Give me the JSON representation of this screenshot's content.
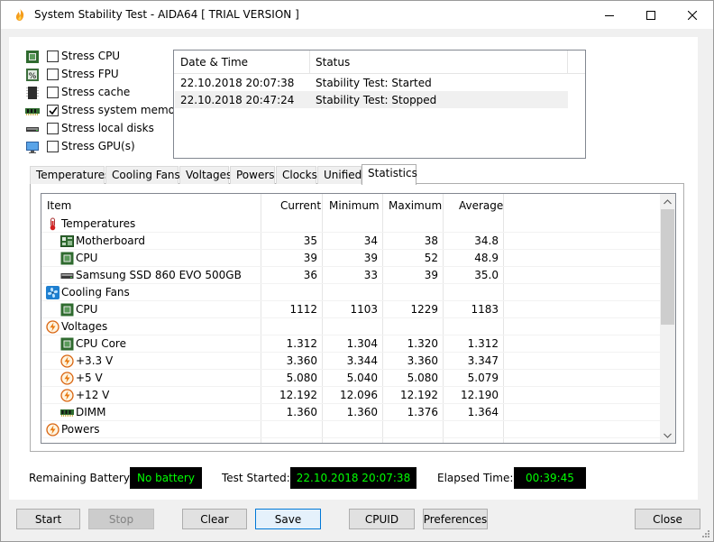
{
  "window": {
    "title": "System Stability Test - AIDA64  [ TRIAL VERSION ]",
    "colors": {
      "accent": "#0078d7",
      "panel_bg": "#000000",
      "panel_text": "#00ff00"
    }
  },
  "stress_options": [
    {
      "label": "Stress CPU",
      "checked": false,
      "icon": "cpu-icon"
    },
    {
      "label": "Stress FPU",
      "checked": false,
      "icon": "fpu-icon"
    },
    {
      "label": "Stress cache",
      "checked": false,
      "icon": "cache-icon"
    },
    {
      "label": "Stress system memory",
      "checked": true,
      "icon": "memory-icon"
    },
    {
      "label": "Stress local disks",
      "checked": false,
      "icon": "disk-icon"
    },
    {
      "label": "Stress GPU(s)",
      "checked": false,
      "icon": "monitor-icon"
    }
  ],
  "log": {
    "headers": {
      "datetime": "Date & Time",
      "status": "Status"
    },
    "rows": [
      {
        "datetime": "22.10.2018 20:07:38",
        "status": "Stability Test: Started"
      },
      {
        "datetime": "22.10.2018 20:47:24",
        "status": "Stability Test: Stopped"
      }
    ]
  },
  "tabs": [
    "Temperatures",
    "Cooling Fans",
    "Voltages",
    "Powers",
    "Clocks",
    "Unified",
    "Statistics"
  ],
  "active_tab": "Statistics",
  "stats": {
    "headers": {
      "item": "Item",
      "current": "Current",
      "minimum": "Minimum",
      "maximum": "Maximum",
      "average": "Average"
    },
    "rows": [
      {
        "type": "group",
        "name": "Temperatures",
        "icon": "thermometer-icon"
      },
      {
        "type": "item",
        "name": "Motherboard",
        "icon": "motherboard-icon",
        "current": "35",
        "minimum": "34",
        "maximum": "38",
        "average": "34.8"
      },
      {
        "type": "item",
        "name": "CPU",
        "icon": "cpu-icon",
        "current": "39",
        "minimum": "39",
        "maximum": "52",
        "average": "48.9"
      },
      {
        "type": "item",
        "name": "Samsung SSD 860 EVO 500GB",
        "icon": "disk-icon",
        "current": "36",
        "minimum": "33",
        "maximum": "39",
        "average": "35.0"
      },
      {
        "type": "group",
        "name": "Cooling Fans",
        "icon": "fan-icon"
      },
      {
        "type": "item",
        "name": "CPU",
        "icon": "cpu-icon",
        "current": "1112",
        "minimum": "1103",
        "maximum": "1229",
        "average": "1183"
      },
      {
        "type": "group",
        "name": "Voltages",
        "icon": "voltage-icon"
      },
      {
        "type": "item",
        "name": "CPU Core",
        "icon": "cpu-icon",
        "current": "1.312",
        "minimum": "1.304",
        "maximum": "1.320",
        "average": "1.312"
      },
      {
        "type": "item",
        "name": "+3.3 V",
        "icon": "voltage-icon",
        "current": "3.360",
        "minimum": "3.344",
        "maximum": "3.360",
        "average": "3.347"
      },
      {
        "type": "item",
        "name": "+5 V",
        "icon": "voltage-icon",
        "current": "5.080",
        "minimum": "5.040",
        "maximum": "5.080",
        "average": "5.079"
      },
      {
        "type": "item",
        "name": "+12 V",
        "icon": "voltage-icon",
        "current": "12.192",
        "minimum": "12.096",
        "maximum": "12.192",
        "average": "12.190"
      },
      {
        "type": "item",
        "name": "DIMM",
        "icon": "memory-icon",
        "current": "1.360",
        "minimum": "1.360",
        "maximum": "1.376",
        "average": "1.364"
      },
      {
        "type": "group",
        "name": "Powers",
        "icon": "power-icon"
      }
    ]
  },
  "footer": {
    "battery_label": "Remaining Battery:",
    "battery_value": "No battery",
    "started_label": "Test Started:",
    "started_value": "22.10.2018 20:07:38",
    "elapsed_label": "Elapsed Time:",
    "elapsed_value": "00:39:45"
  },
  "buttons": {
    "start": "Start",
    "stop": "Stop",
    "clear": "Clear",
    "save": "Save",
    "cpuid": "CPUID",
    "preferences": "Preferences",
    "close": "Close"
  }
}
